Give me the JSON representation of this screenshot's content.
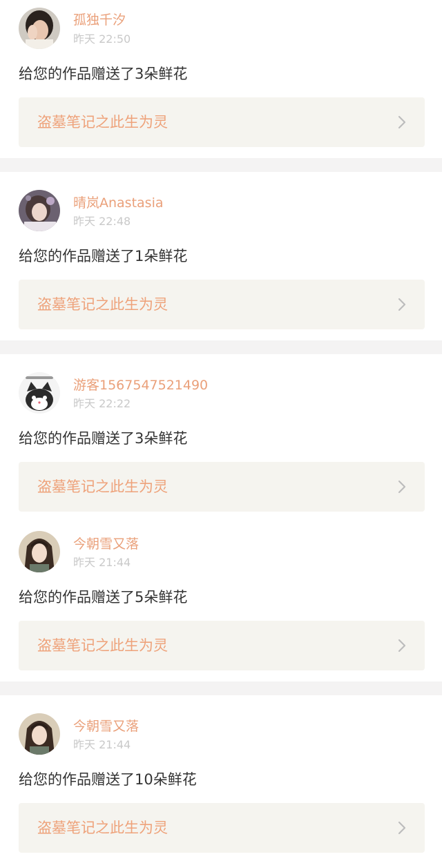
{
  "colors": {
    "accent": "#eaa07a",
    "work_bg": "#f5f4ef",
    "separator": "#f4f3f3",
    "time": "#c9c9c9",
    "message": "#333333"
  },
  "items": [
    {
      "user": "孤独千汐",
      "time": "昨天 22:50",
      "message": "给您的作品赠送了3朵鲜花",
      "work_title": "盗墓笔记之此生为灵",
      "avatar_icon": "girl-covering-face-avatar"
    },
    {
      "user": "晴岚Anastasia",
      "time": "昨天 22:48",
      "message": "给您的作品赠送了1朵鲜花",
      "work_title": "盗墓笔记之此生为灵",
      "avatar_icon": "girl-portrait-avatar"
    },
    {
      "user": "游客1567547521490",
      "time": "昨天 22:22",
      "message": "给您的作品赠送了3朵鲜花",
      "work_title": "盗墓笔记之此生为灵",
      "avatar_icon": "cartoon-cat-avatar"
    },
    {
      "user": "今朝雪又落",
      "time": "昨天 21:44",
      "message": "给您的作品赠送了5朵鲜花",
      "work_title": "盗墓笔记之此生为灵",
      "avatar_icon": "anime-character-avatar"
    },
    {
      "user": "今朝雪又落",
      "time": "昨天 21:44",
      "message": "给您的作品赠送了10朵鲜花",
      "work_title": "盗墓笔记之此生为灵",
      "avatar_icon": "anime-character-avatar"
    }
  ]
}
